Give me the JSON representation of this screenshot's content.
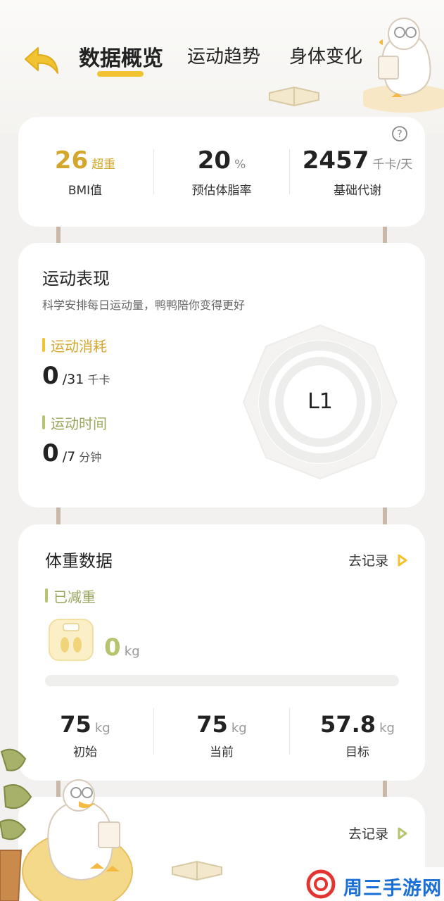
{
  "header": {
    "tabs": [
      {
        "label": "数据概览"
      },
      {
        "label": "运动趋势"
      },
      {
        "label": "身体变化"
      }
    ]
  },
  "body_stats": {
    "bmi": {
      "value": "26",
      "unit": "超重",
      "label": "BMI值"
    },
    "fat": {
      "value": "20",
      "unit": "%",
      "label": "预估体脂率"
    },
    "bmr": {
      "value": "2457",
      "unit": "千卡/天",
      "label": "基础代谢"
    }
  },
  "exercise": {
    "title": "运动表现",
    "subtitle": "科学安排每日运动量，鸭鸭陪你变得更好",
    "burn": {
      "label": "运动消耗",
      "value": "0",
      "target": "/31",
      "unit": "千卡"
    },
    "time": {
      "label": "运动时间",
      "value": "0",
      "target": "/7",
      "unit": "分钟"
    },
    "level": "L1"
  },
  "weight": {
    "title": "体重数据",
    "record_label": "去记录",
    "lost_label": "已减重",
    "lost_value": "0",
    "lost_unit": "kg",
    "progress": 0,
    "initial": {
      "value": "75",
      "unit": "kg",
      "label": "初始"
    },
    "current": {
      "value": "75",
      "unit": "kg",
      "label": "当前"
    },
    "target": {
      "value": "57.8",
      "unit": "kg",
      "label": "目标"
    }
  },
  "next_card": {
    "record_label": "去记录"
  },
  "watermark": {
    "text": "周三手游网"
  },
  "colors": {
    "accent": "#f1c232",
    "green": "#b7c36e",
    "card": "#ffffff"
  }
}
